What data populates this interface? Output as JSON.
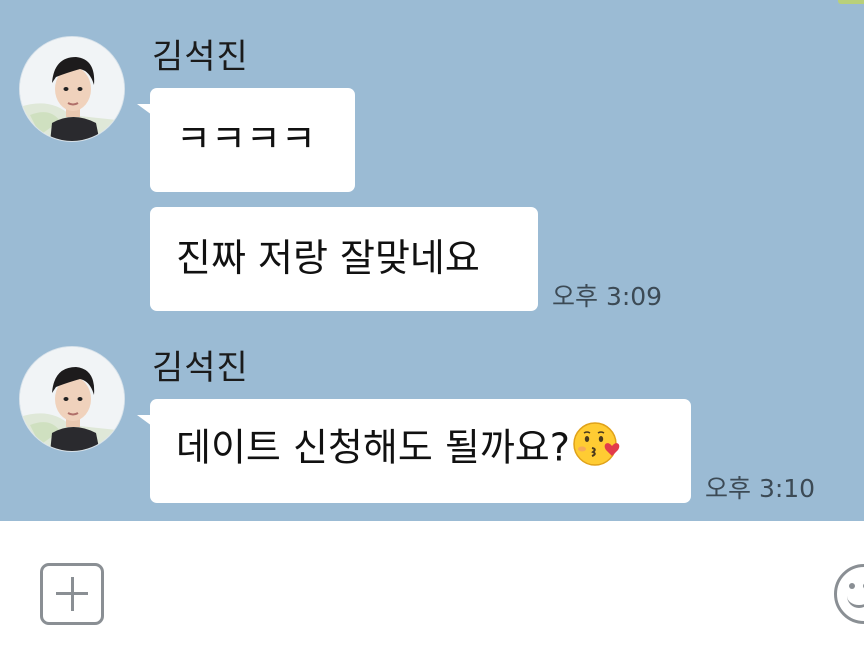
{
  "chat": {
    "groups": [
      {
        "sender": "김석진",
        "messages": [
          {
            "text": "ㅋㅋㅋㅋ"
          },
          {
            "text": "진짜 저랑 잘맞네요",
            "time": "오후 3:09"
          }
        ]
      },
      {
        "sender": "김석진",
        "messages": [
          {
            "text": "데이트 신청해도 될까요?",
            "emoji": "kissing-face-with-heart-emoji",
            "time": "오후 3:10"
          }
        ]
      }
    ]
  },
  "input_bar": {
    "add_icon": "plus-icon",
    "emoji_icon": "smiley-face-icon"
  },
  "colors": {
    "chat_background": "#9bbbd4",
    "bubble": "#ffffff",
    "input_bar": "#ffffff",
    "icon": "#8a8f94"
  }
}
